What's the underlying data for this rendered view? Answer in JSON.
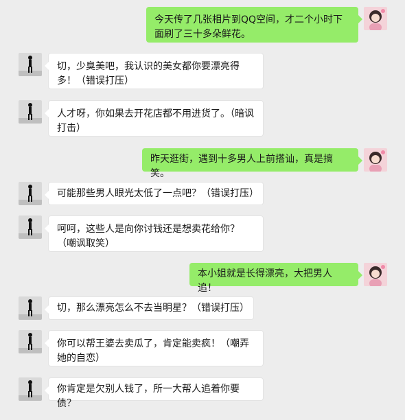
{
  "colors": {
    "background": "#ededed",
    "incoming_bubble": "#ffffff",
    "outgoing_bubble": "#95ec69",
    "text": "#1a1a1a"
  },
  "contacts": {
    "self_avatar_icon": "girl-photo-avatar",
    "other_avatar_icon": "silhouette-man-avatar"
  },
  "messages": [
    {
      "side": "outgoing",
      "text": "今天传了几张相片到QQ空间，才二个小时下面刷了三十多朵鲜花。"
    },
    {
      "side": "incoming",
      "text": "切，少臭美吧，我认识的美女都你要漂亮得多！（错误打压）"
    },
    {
      "side": "incoming",
      "text": "人才呀，你如果去开花店都不用进货了。（暗讽打击）"
    },
    {
      "side": "outgoing",
      "text": "昨天逛街，遇到十多男人上前搭讪，真是搞笑。"
    },
    {
      "side": "incoming",
      "text": "可能那些男人眼光太低了一点吧？（错误打压）"
    },
    {
      "side": "incoming",
      "text": "呵呵，这些人是向你讨钱还是想卖花给你？（嘲讽取笑）"
    },
    {
      "side": "outgoing",
      "text": "本小姐就是长得漂亮，大把男人追！"
    },
    {
      "side": "incoming",
      "text": "切，那么漂亮怎么不去当明星？（错误打压）"
    },
    {
      "side": "incoming",
      "text": "你可以帮王婆去卖瓜了，肯定能卖疯！（嘲弄她的自恋）"
    },
    {
      "side": "incoming",
      "text": "你肯定是欠别人钱了，所一大帮人追着你要债？"
    }
  ]
}
